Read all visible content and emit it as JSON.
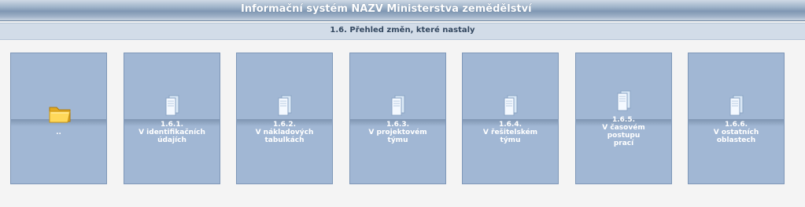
{
  "header": {
    "title": "Informační systém NAZV Ministerstva zemědělství"
  },
  "section": {
    "title": "1.6. Přehled změn, které nastaly"
  },
  "tiles": [
    {
      "icon": "folder-icon",
      "lines": [
        ".."
      ]
    },
    {
      "icon": "document-icon",
      "lines": [
        "1.6.1.",
        "V identifikačních",
        "údajích"
      ]
    },
    {
      "icon": "document-icon",
      "lines": [
        "1.6.2.",
        "V nákladových",
        "tabulkách"
      ]
    },
    {
      "icon": "document-icon",
      "lines": [
        "1.6.3.",
        "V projektovém",
        "týmu"
      ]
    },
    {
      "icon": "document-icon",
      "lines": [
        "1.6.4.",
        "V řešitelském",
        "týmu"
      ]
    },
    {
      "icon": "document-icon",
      "lines": [
        "1.6.5.",
        "V časovém",
        "postupu",
        "prací"
      ]
    },
    {
      "icon": "document-icon",
      "lines": [
        "1.6.6.",
        "V ostatních",
        "oblastech"
      ]
    }
  ],
  "colors": {
    "tile": "#a1b7d4",
    "tile_border": "#7e97b8",
    "header_text": "#ffffff",
    "section_text": "#33475f",
    "folder": "#f4c542"
  }
}
